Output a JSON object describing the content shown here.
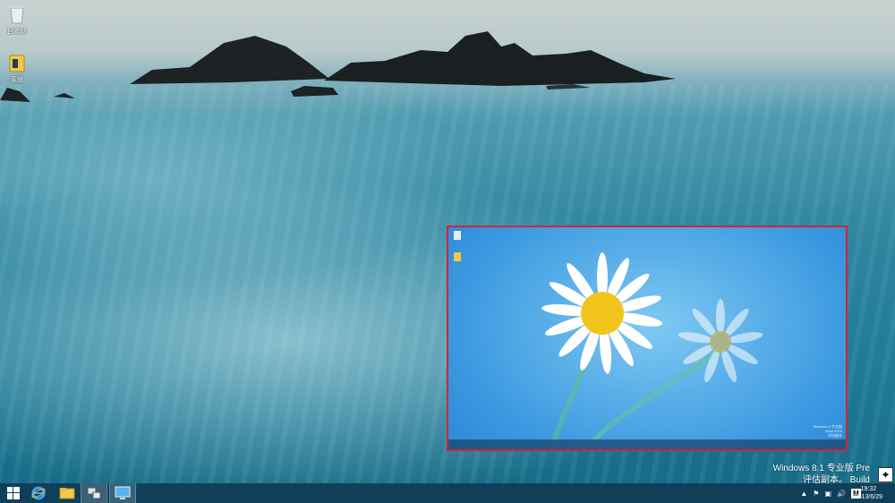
{
  "desktop": {
    "icons": [
      {
        "label": "回收站",
        "icon": "recycle-bin-icon"
      },
      {
        "label": "系统",
        "icon": "folder-icon"
      }
    ]
  },
  "preview": {
    "watermark_lines": [
      "Windows 8 专业版",
      "Build 9200",
      "评估副本"
    ]
  },
  "watermark": {
    "line1": "Windows 8.1 专业版 Pre",
    "line2": "评估副本。 Build"
  },
  "taskbar": {
    "apps": [
      {
        "name": "start",
        "icon": "windows-logo-icon"
      },
      {
        "name": "internet-explorer",
        "icon": "internet-explorer-icon"
      },
      {
        "name": "file-explorer",
        "icon": "folder-icon"
      },
      {
        "name": "network-app",
        "icon": "network-computer-icon"
      },
      {
        "name": "screen-app",
        "icon": "monitor-icon"
      }
    ],
    "tray": {
      "ime_label": "M"
    },
    "clock": {
      "time": "19:32",
      "date": "2013/6/29"
    }
  },
  "colors": {
    "selection_border": "#d0243a",
    "taskbar": "#0f3c55",
    "sea": "#2f86a0",
    "preview_sky": "#3a98e0"
  }
}
